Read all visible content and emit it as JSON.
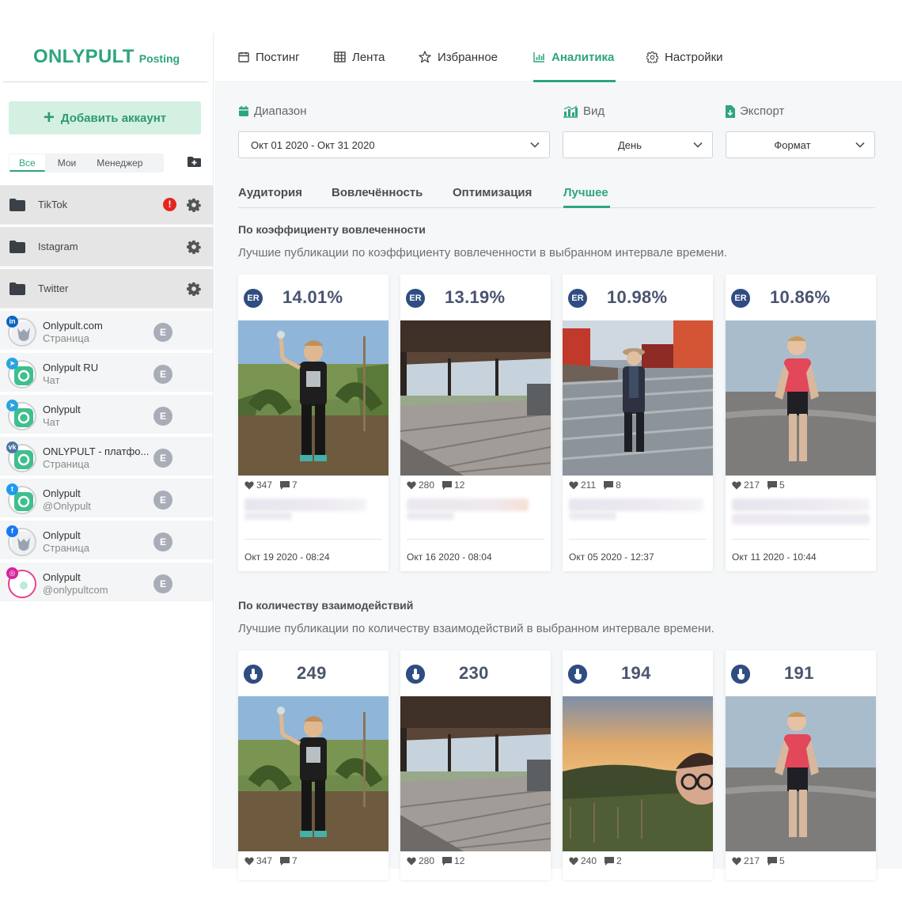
{
  "brand": {
    "name": "ONLYPULT",
    "sub": "Posting",
    "accent": "#2ea57d"
  },
  "sidebar": {
    "add_account": "Добавить аккаунт",
    "filters": [
      "Все",
      "Мои",
      "Менеджер"
    ],
    "groups": [
      {
        "name": "TikTok",
        "alert": "!"
      },
      {
        "name": "Istagram"
      },
      {
        "name": "Twitter"
      }
    ],
    "accounts": [
      {
        "network": "in",
        "name": "Onlypult.com",
        "type": "Страница",
        "tag": "E"
      },
      {
        "network": "tg",
        "name": "Onlypult RU",
        "type": "Чат",
        "tag": "E"
      },
      {
        "network": "tg",
        "name": "Onlypult",
        "type": "Чат",
        "tag": "E"
      },
      {
        "network": "vk",
        "name": "ONLYPULT - платфо...",
        "type": "Страница",
        "tag": "E"
      },
      {
        "network": "tw",
        "name": "Onlypult",
        "type": "@Onlypult",
        "tag": "E"
      },
      {
        "network": "fb",
        "name": "Onlypult",
        "type": "Страница",
        "tag": "E"
      },
      {
        "network": "ig",
        "name": "Onlypult",
        "type": "@onlypultcom",
        "tag": "E"
      }
    ]
  },
  "nav": {
    "items": [
      "Постинг",
      "Лента",
      "Избранное",
      "Аналитика",
      "Настройки"
    ],
    "active": "Аналитика"
  },
  "controls": {
    "range_label": "Диапазон",
    "range_value": "Окт 01 2020 - Окт 31 2020",
    "view_label": "Вид",
    "view_value": "День",
    "export_label": "Экспорт",
    "export_value": "Формат"
  },
  "subtabs": [
    "Аудитория",
    "Вовлечённость",
    "Оптимизация",
    "Лучшее"
  ],
  "active_subtab": "Лучшее",
  "section1": {
    "title": "По коэффициенту вовлеченности",
    "desc": "Лучшие публикации по коэффициенту вовлеченности в выбранном интервале времени.",
    "icon_label": "ER",
    "cards": [
      {
        "value": "14.01%",
        "likes": "347",
        "comments": "7",
        "date": "Окт 19 2020 - 08:24"
      },
      {
        "value": "13.19%",
        "likes": "280",
        "comments": "12",
        "date": "Окт 16 2020 - 08:04"
      },
      {
        "value": "10.98%",
        "likes": "211",
        "comments": "8",
        "date": "Окт 05 2020 - 12:37"
      },
      {
        "value": "10.86%",
        "likes": "217",
        "comments": "5",
        "date": "Окт 11 2020 - 10:44"
      }
    ]
  },
  "section2": {
    "title": "По количеству взаимодействий",
    "desc": "Лучшие публикации по количеству взаимодействий в выбранном интервале времени.",
    "cards": [
      {
        "value": "249",
        "likes": "347",
        "comments": "7"
      },
      {
        "value": "230",
        "likes": "280",
        "comments": "12"
      },
      {
        "value": "194",
        "likes": "240",
        "comments": "2"
      },
      {
        "value": "191",
        "likes": "217",
        "comments": "5"
      }
    ]
  }
}
